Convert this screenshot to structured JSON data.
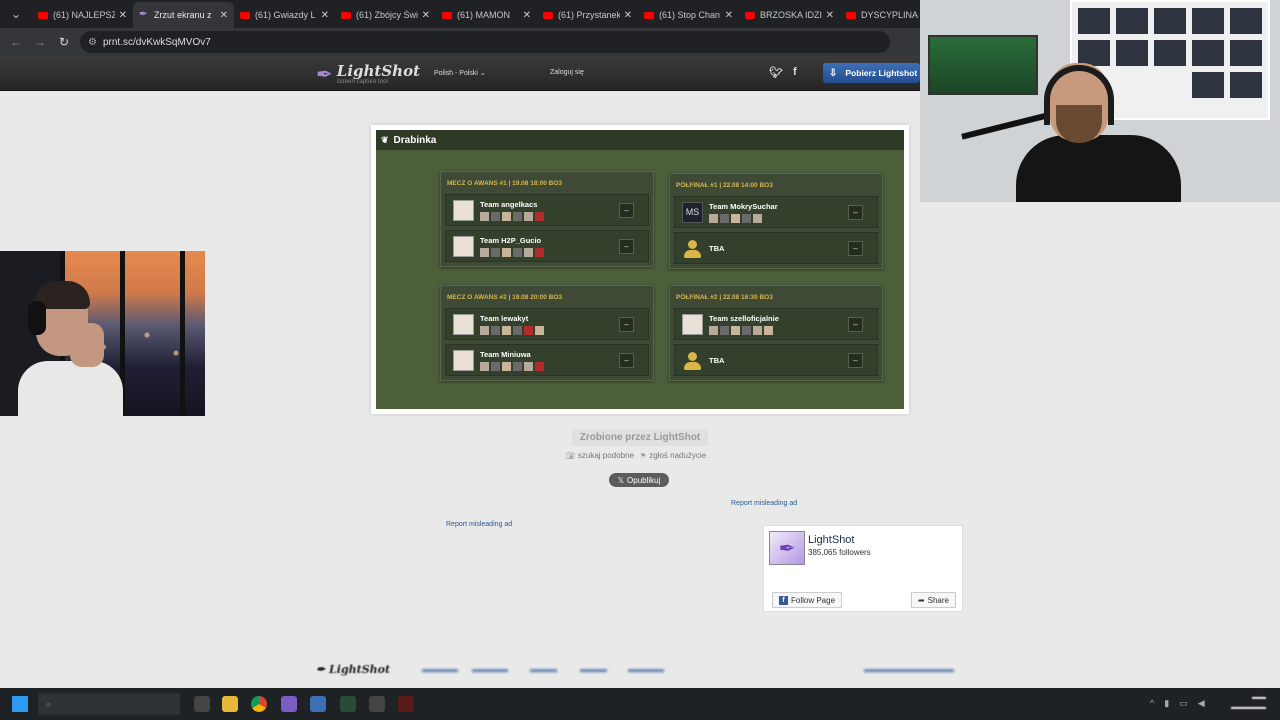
{
  "browser": {
    "tabs": [
      {
        "title": "(61) NAJLEPSZ",
        "type": "youtube",
        "active": false
      },
      {
        "title": "Zrzut ekranu z",
        "type": "lightshot",
        "active": true
      },
      {
        "title": "(61) Gwiazdy L",
        "type": "youtube",
        "active": false
      },
      {
        "title": "(61) Zbójcy Świ",
        "type": "youtube",
        "active": false
      },
      {
        "title": "(61) MAMON",
        "type": "youtube",
        "active": false
      },
      {
        "title": "(61) Przystanek",
        "type": "youtube",
        "active": false
      },
      {
        "title": "(61) Stop Chan",
        "type": "youtube",
        "active": false
      },
      {
        "title": "BRZOSKA IDZI",
        "type": "youtube",
        "active": false
      },
      {
        "title": "DYSCYPLINA (",
        "type": "youtube",
        "active": false
      }
    ],
    "url": "prnt.sc/dvKwkSqMVOv7"
  },
  "header": {
    "logo_name": "LightShot",
    "logo_tagline": "screen capture tool",
    "language": "Polish - Polski",
    "login": "Zaloguj się",
    "download_button": "Pobierz Lightshot"
  },
  "screenshot": {
    "title": "Drabinka",
    "matches": [
      {
        "header": "MECZ O AWANS #1 | 19.08 18:00 BO3",
        "teams": [
          {
            "name": "Team angelkacs",
            "score": "–",
            "avatar": "photo"
          },
          {
            "name": "Team H2P_Gucio",
            "score": "–",
            "avatar": "photo"
          }
        ]
      },
      {
        "header": "PÓŁFINAŁ #1 | 22.08 14:00 BO3",
        "teams": [
          {
            "name": "Team MokrySuchar",
            "score": "–",
            "avatar": "ms",
            "avatar_text": "MS"
          },
          {
            "name": "TBA",
            "score": "–",
            "avatar": "tba"
          }
        ]
      },
      {
        "header": "MECZ O AWANS #2 | 19.08 20:00 BO3",
        "teams": [
          {
            "name": "Team lewakyt",
            "score": "–",
            "avatar": "photo"
          },
          {
            "name": "Team Miniuwa",
            "score": "–",
            "avatar": "photo"
          }
        ]
      },
      {
        "header": "PÓŁFINAŁ #2 | 22.08 16:30 BO3",
        "teams": [
          {
            "name": "Team szelloficjalnie",
            "score": "–",
            "avatar": "photo"
          },
          {
            "name": "TBA",
            "score": "–",
            "avatar": "tba"
          }
        ]
      }
    ]
  },
  "below": {
    "made_by": "Zrobione przez LightShot",
    "search_similar": "szukaj podobne",
    "report_abuse": "zgłoś nadużycie",
    "tweet": "Opublikuj",
    "report_ad": "Report misleading ad"
  },
  "facebook": {
    "page_name": "LightShot",
    "followers": "385,065 followers",
    "follow": "Follow Page",
    "share": "Share"
  },
  "footer": {
    "logo": "LightShot"
  },
  "colors": {
    "ladder_bg": "#4c5f3a",
    "accent_gold": "#d8b64a",
    "lightshot_purple": "#b497e5",
    "download_blue": "#2e5ea3"
  }
}
